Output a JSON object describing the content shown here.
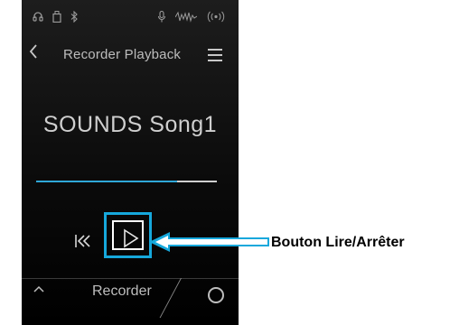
{
  "status_icons": [
    "headphones-icon",
    "usb-drive-icon",
    "bluetooth-icon",
    "microphone-icon",
    "audio-wave-icon",
    "wireless-icon"
  ],
  "header": {
    "title": "Recorder Playback"
  },
  "song": {
    "name": "SOUNDS Song1"
  },
  "playback": {
    "progress": 0.78
  },
  "bottom": {
    "tab_label": "Recorder"
  },
  "callout": {
    "text": "Bouton Lire/Arrêter",
    "color": "#16a8dc"
  }
}
